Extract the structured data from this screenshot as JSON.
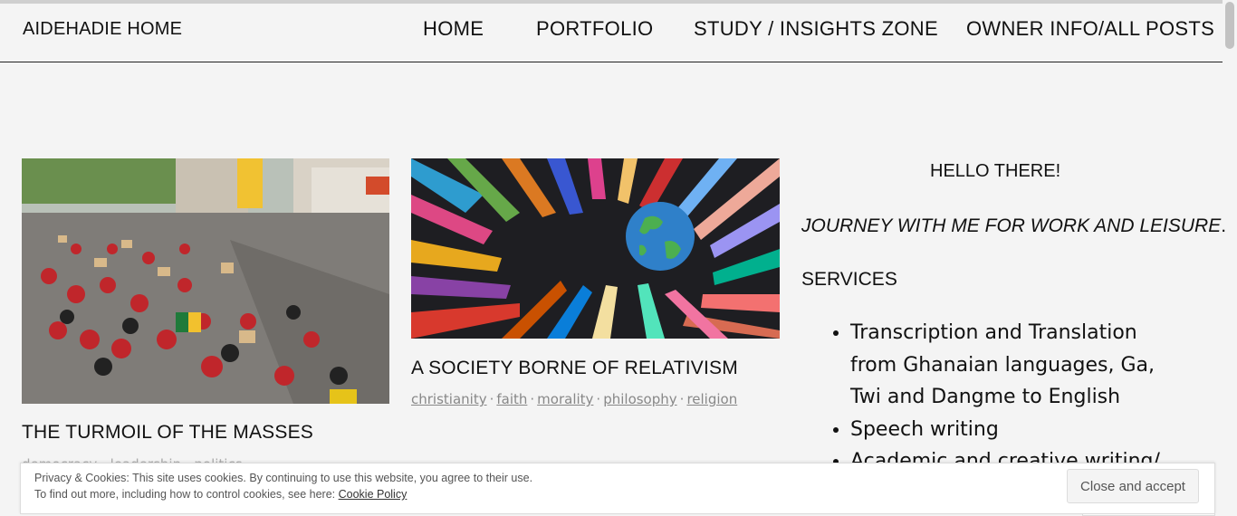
{
  "header": {
    "site_title": "AIDEHADIE HOME",
    "nav": [
      "HOME",
      "PORTFOLIO",
      "STUDY / INSIGHTS ZONE",
      "OWNER INFO/ALL POSTS"
    ]
  },
  "posts": [
    {
      "title": "THE TURMOIL OF THE MASSES",
      "image": "protest-march-photo",
      "tags_partial": "democracy · leadership · politics"
    },
    {
      "title": "A SOCIETY BORNE OF RELATIVISM",
      "image": "colorful-hands-globe-collage",
      "tags": [
        "christianity",
        "faith",
        "morality",
        "philosophy",
        "religion"
      ]
    }
  ],
  "sidebar": {
    "greeting": "HELLO THERE!",
    "tagline": "JOURNEY WITH ME FOR WORK AND LEISURE",
    "tagline_period": ".",
    "services_heading": "SERVICES",
    "services": [
      "Transcription and Translation from Ghanaian languages, Ga, Twi and Dangme to English",
      "Speech writing",
      "Academic and creative writing/"
    ]
  },
  "cookie": {
    "line1": "Privacy & Cookies: This site uses cookies. By continuing to use this website, you agree to their use.",
    "line2": "To find out more, including how to control cookies, see here: ",
    "link": "Cookie Policy",
    "button": "Close and accept"
  },
  "colors": {
    "background": "#f4f4f4",
    "tag_text": "#888888",
    "text": "#111111"
  }
}
